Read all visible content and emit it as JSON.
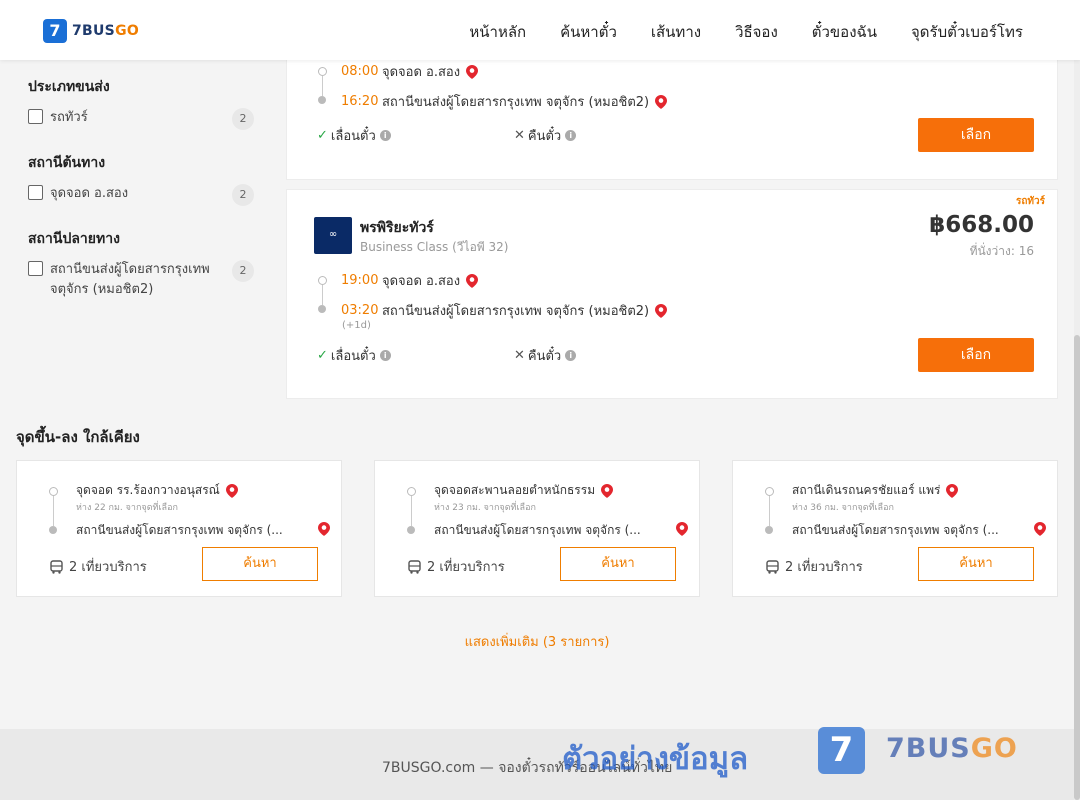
{
  "header": {
    "logo_digit": "7",
    "logo_text_a": "7BUS",
    "logo_text_b": "GO",
    "nav": [
      "หน้าหลัก",
      "ค้นหาตั๋ว",
      "เส้นทาง",
      "วิธีจอง",
      "ตั๋วของฉัน",
      "จุดรับตั๋วเบอร์โทร"
    ]
  },
  "filters": [
    {
      "title": "ประเภทขนส่ง",
      "label": "รถทัวร์",
      "count": "2"
    },
    {
      "title": "สถานีต้นทาง",
      "label": "จุดจอด อ.สอง",
      "count": "2"
    },
    {
      "title": "สถานีปลายทาง",
      "label": "สถานีขนส่งผู้โดยสารกรุงเทพ จตุจักร (หมอชิต2)",
      "count": "2"
    }
  ],
  "trip1": {
    "dep_time": "08:00",
    "dep_stop": "จุดจอด อ.สอง",
    "arr_time": "16:20",
    "arr_stop": "สถานีขนส่งผู้โดยสารกรุงเทพ จตุจักร (หมอชิต2)",
    "policy_change": "เลื่อนตั๋ว",
    "policy_refund": "คืนตั๋ว",
    "select_label": "เลือก"
  },
  "trip2": {
    "tag": "รถทัวร์",
    "operator": "พรพิริยะทัวร์",
    "class": "Business Class (วีไอพี 32)",
    "price": "฿668.00",
    "seats": "ที่นั่งว่าง: 16",
    "dep_time": "19:00",
    "dep_stop": "จุดจอด อ.สอง",
    "arr_time": "03:20",
    "arr_stop": "สถานีขนส่งผู้โดยสารกรุงเทพ จตุจักร (หมอชิต2)",
    "next_day": "(+1d)",
    "policy_change": "เลื่อนตั๋ว",
    "policy_refund": "คืนตั๋ว",
    "select_label": "เลือก"
  },
  "nearby": {
    "title": "จุดขึ้น-ลง ใกล้เคียง",
    "cards": [
      {
        "from": "จุดจอด รร.ร้องกวางอนุสรณ์",
        "distance": "ห่าง 22 กม. จากจุดที่เลือก",
        "to": "สถานีขนส่งผู้โดยสารกรุงเทพ จตุจักร (...",
        "trips": "2 เที่ยวบริการ",
        "button": "ค้นหา"
      },
      {
        "from": "จุดจอดสะพานลอยตำหนักธรรม",
        "distance": "ห่าง 23 กม. จากจุดที่เลือก",
        "to": "สถานีขนส่งผู้โดยสารกรุงเทพ จตุจักร (...",
        "trips": "2 เที่ยวบริการ",
        "button": "ค้นหา"
      },
      {
        "from": "สถานีเดินรถนครชัยแอร์ แพร่",
        "distance": "ห่าง 36 กม. จากจุดที่เลือก",
        "to": "สถานีขนส่งผู้โดยสารกรุงเทพ จตุจักร (...",
        "trips": "2 เที่ยวบริการ",
        "button": "ค้นหา"
      }
    ],
    "show_more": "แสดงเพิ่มเติม (3 รายการ)"
  },
  "footer": {
    "text": "7BUSGO.com — จองตั๋วรถทัวร์ออนไลน์ทั่วไทย",
    "watermark": "ตัวอย่างข้อมูล",
    "wm_digit": "7",
    "wm_text_a": "7BUS",
    "wm_text_b": "GO"
  },
  "colors": {
    "accent": "#f66f0a",
    "brand_blue": "#1a6fd6",
    "time": "#ef7d00"
  }
}
